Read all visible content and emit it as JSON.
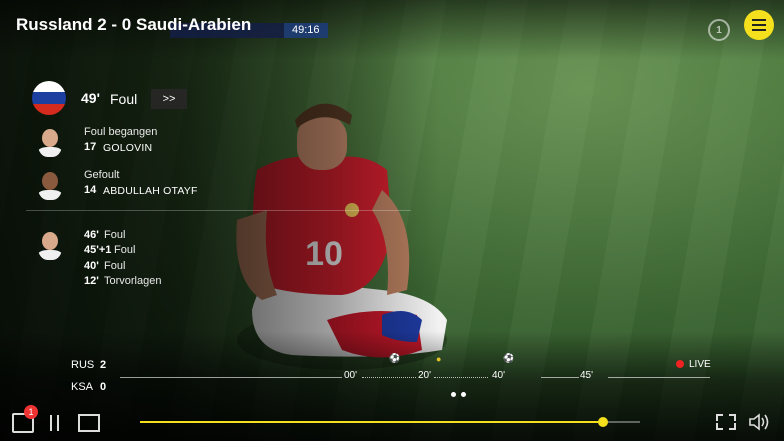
{
  "match": {
    "title": "Russland 2 - 0 Saudi-Arabien",
    "scorebug_time": "49:16"
  },
  "event": {
    "minute": "49'",
    "type": "Foul",
    "more_label": ">>",
    "committed_label": "Foul begangen",
    "committed_number": "17",
    "committed_name": "GOLOVIN",
    "victim_label": "Gefoult",
    "victim_number": "14",
    "victim_name": "ABDULLAH OTAYF"
  },
  "player_stats": [
    {
      "minute": "46'",
      "text": "Foul"
    },
    {
      "minute": "45'+1",
      "text": "Foul"
    },
    {
      "minute": "40'",
      "text": "Foul"
    },
    {
      "minute": "12'",
      "text": "Torvorlagen"
    }
  ],
  "timeline": {
    "home_team": "RUS",
    "home_score": "2",
    "away_team": "KSA",
    "away_score": "0",
    "ticks": [
      "00'",
      "20'",
      "40'",
      "45'"
    ],
    "live_label": "LIVE"
  },
  "controls": {
    "chat_badge": "1",
    "progress": 0.925
  },
  "colors": {
    "accent": "#f4e01c",
    "live": "#e22222",
    "flag_ru": [
      "#ffffff",
      "#1c3fa0",
      "#d52b1e"
    ]
  }
}
